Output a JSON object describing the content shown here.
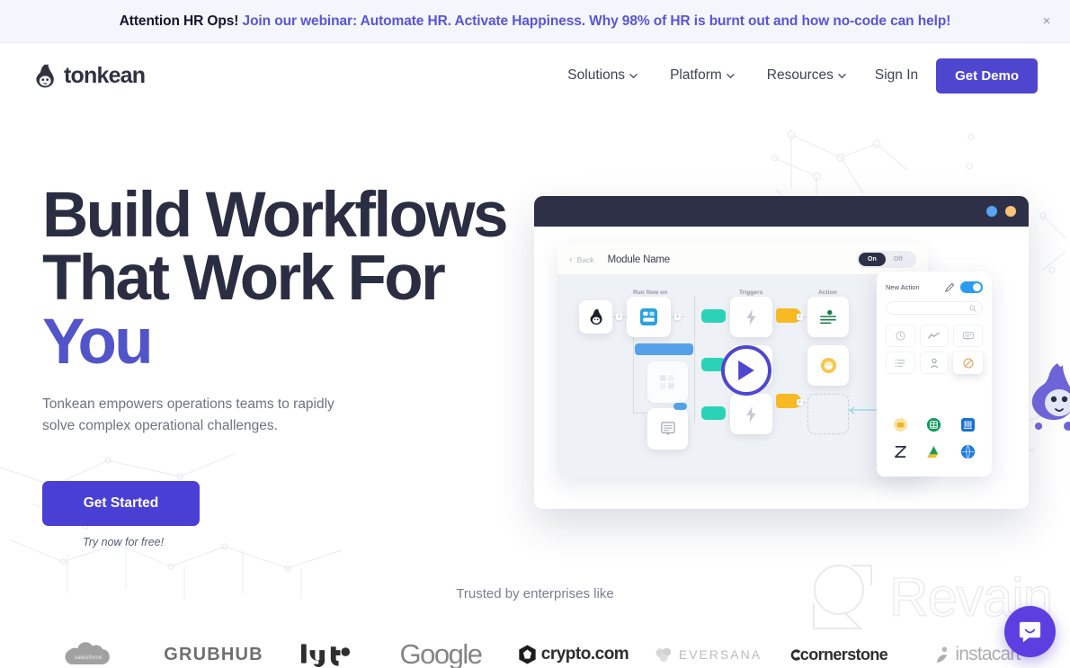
{
  "banner": {
    "strong": "Attention HR Ops!",
    "link": "Join our webinar: Automate HR. Activate Happiness. Why 98% of HR is burnt out and how no-code can help!",
    "close": "×",
    "bg_color": "#f3f6fd",
    "link_color": "#5a55d6"
  },
  "header": {
    "logo_text": "tonkean",
    "nav": [
      {
        "label": "Solutions",
        "has_caret": true
      },
      {
        "label": "Platform",
        "has_caret": true
      },
      {
        "label": "Resources",
        "has_caret": true
      }
    ],
    "signin": "Sign In",
    "demo_button": "Get Demo",
    "demo_color": "#4f46cf"
  },
  "hero": {
    "heading_line1": "Build Workflows",
    "heading_line2": "That Work For",
    "heading_accent": "You",
    "accent_color": "#5255c9",
    "heading_color": "#2b2d42",
    "subtext_line1": "Tonkean empowers operations teams to rapidly",
    "subtext_line2": "solve complex operational challenges.",
    "cta_label": "Get Started",
    "cta_color": "#4a3fd4",
    "cta_note": "Try now for free!"
  },
  "product": {
    "window_dots": [
      "blue",
      "amber"
    ],
    "back_label": "Back",
    "module_name": "Module Name",
    "toggle_on": "On",
    "toggle_off": "Off",
    "column_labels": [
      "Run flow on",
      "Triggers",
      "Action"
    ],
    "panel": {
      "title": "New Action",
      "edit_icon": "pencil-icon",
      "toggle_state": "on",
      "search_icon": "search-icon",
      "tool_icons": [
        "clock-icon",
        "trend-icon",
        "form-icon",
        "list-icon",
        "person-icon",
        "block-icon"
      ],
      "app_icons": [
        "mail-app-icon",
        "sheets-app-icon",
        "slack-app-icon",
        "zendesk-app-icon",
        "drive-app-icon",
        "circle-app-icon"
      ]
    },
    "play_button": "play-icon"
  },
  "trusted": {
    "heading": "Trusted by enterprises like",
    "logos": [
      "salesforce",
      "GRUBHUB",
      "lyft",
      "Google",
      "crypto.com",
      "EVERSANA",
      "cornerstone",
      "instacart"
    ]
  },
  "watermark": {
    "text": "Revain"
  },
  "chat": {
    "icon": "chat-bubble-icon",
    "color": "#5b3fe0"
  }
}
